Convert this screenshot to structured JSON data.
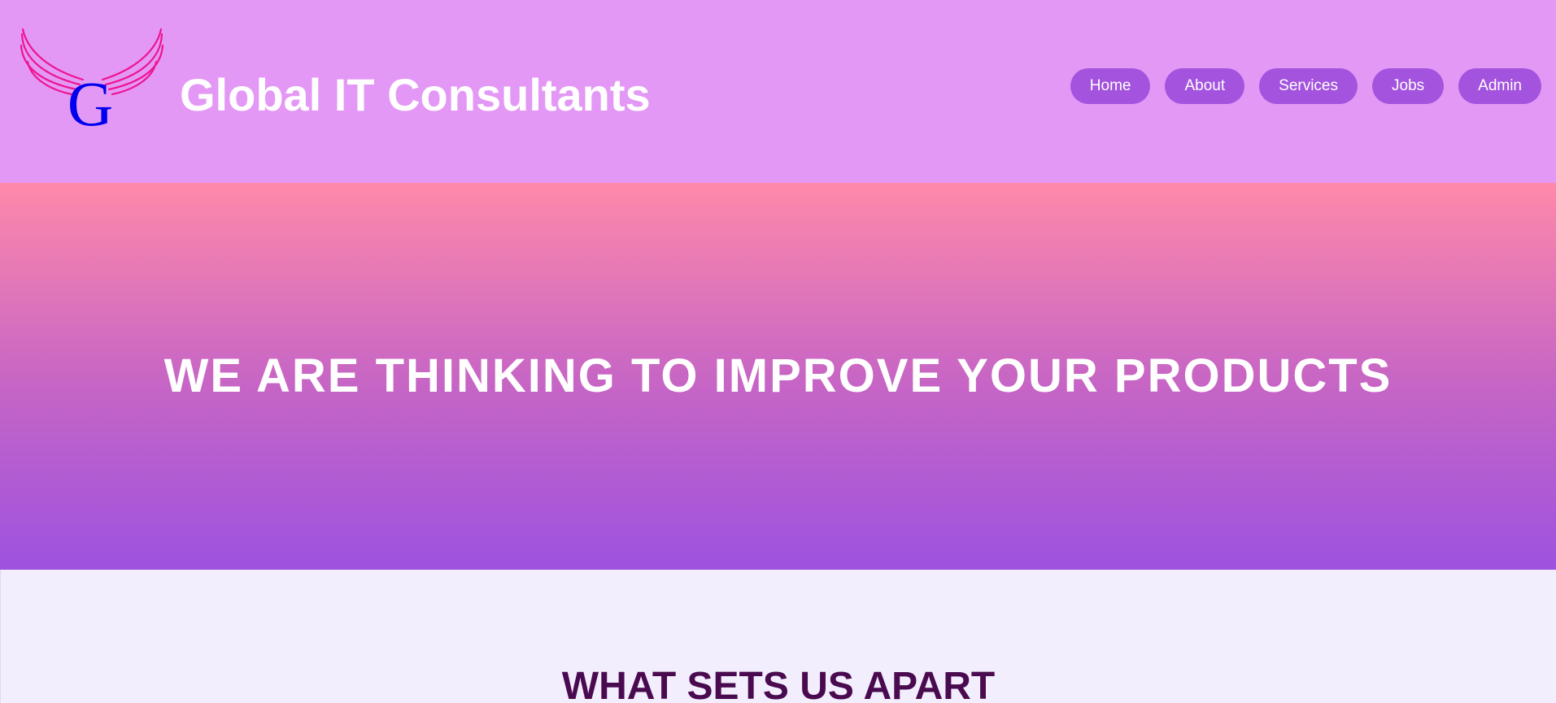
{
  "header": {
    "title": "Global IT Consultants",
    "logo": {
      "letter": "G",
      "icon": "winged-g-logo",
      "letter_color": "#0000ee",
      "wing_color": "#ee1493"
    },
    "nav": [
      {
        "label": "Home"
      },
      {
        "label": "About"
      },
      {
        "label": "Services"
      },
      {
        "label": "Jobs"
      },
      {
        "label": "Admin"
      }
    ]
  },
  "hero": {
    "heading": "WE ARE THINKING TO IMPROVE YOUR PRODUCTS"
  },
  "features": {
    "heading": "WHAT SETS US APART"
  },
  "colors": {
    "header_bg": "#e498f5",
    "nav_pill": "#a453df",
    "hero_gradient_top": "#ff89aa",
    "hero_gradient_bottom": "#9d52e0",
    "section_bg": "#f3eefe",
    "section_heading": "#4a0a4f"
  }
}
